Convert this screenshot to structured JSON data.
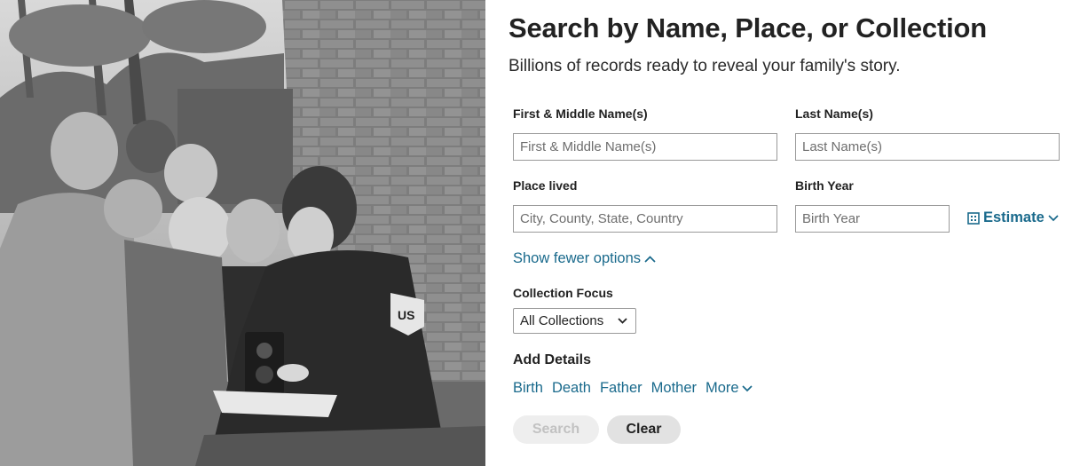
{
  "hero": {
    "image": "black-and-white-photo-children-and-woman-in-us-uniform-with-camera",
    "sleeve_patch_text": "US"
  },
  "form": {
    "title": "Search by Name, Place, or Collection",
    "subtitle": "Billions of records ready to reveal your family's story.",
    "first_name": {
      "label": "First & Middle Name(s)",
      "placeholder": "First & Middle Name(s)",
      "value": ""
    },
    "last_name": {
      "label": "Last Name(s)",
      "placeholder": "Last Name(s)",
      "value": ""
    },
    "place_lived": {
      "label": "Place lived",
      "placeholder": "City, County, State, Country",
      "value": ""
    },
    "birth_year": {
      "label": "Birth Year",
      "placeholder": "Birth Year",
      "value": ""
    },
    "estimate_label": "Estimate",
    "show_fewer_label": "Show fewer options",
    "collection_focus": {
      "label": "Collection Focus",
      "selected": "All Collections"
    },
    "add_details": {
      "title": "Add Details",
      "links": [
        "Birth",
        "Death",
        "Father",
        "Mother"
      ],
      "more_label": "More"
    },
    "search_label": "Search",
    "clear_label": "Clear"
  },
  "colors": {
    "link": "#1a6a8c",
    "text": "#222222",
    "disabled_button_bg": "#eeeeee",
    "disabled_button_text": "#c2c2c2",
    "secondary_button_bg": "#e2e2e2"
  }
}
